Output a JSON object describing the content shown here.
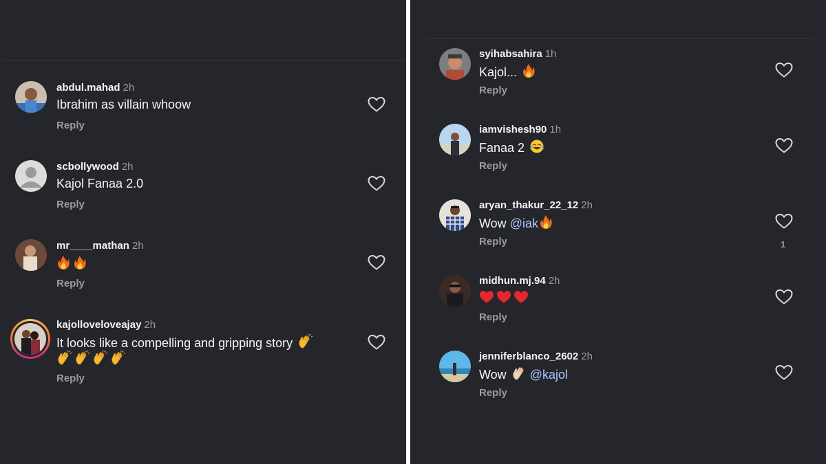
{
  "left": {
    "comments": [
      {
        "username": "abdul.mahad",
        "time": "2h",
        "text": "Ibrahim as villain whoow",
        "reply": "Reply"
      },
      {
        "username": "scbollywood",
        "time": "2h",
        "text": "Kajol Fanaa 2.0",
        "reply": "Reply"
      },
      {
        "username": "mr____mathan",
        "time": "2h",
        "text": "",
        "emoji": [
          "fire-emoji",
          "fire-emoji"
        ],
        "reply": "Reply"
      },
      {
        "username": "kajolloveloveajay",
        "time": "2h",
        "text": "It looks like a compelling and gripping story",
        "emoji": [
          "clapping-hands-emoji",
          "clapping-hands-emoji",
          "clapping-hands-emoji",
          "clapping-hands-emoji",
          "clapping-hands-emoji"
        ],
        "reply": "Reply"
      }
    ]
  },
  "right": {
    "comments": [
      {
        "username": "syihabsahira",
        "time": "1h",
        "text": "Kajol...",
        "emoji": [
          "fire-emoji"
        ],
        "reply": "Reply"
      },
      {
        "username": "iamvishesh90",
        "time": "1h",
        "text": "Fanaa 2",
        "emoji": [
          "tears-of-joy-emoji"
        ],
        "reply": "Reply"
      },
      {
        "username": "aryan_thakur_22_12",
        "time": "2h",
        "text": "Wow",
        "mention": "@iak",
        "emoji": [
          "fire-emoji"
        ],
        "reply": "Reply",
        "likes": "1"
      },
      {
        "username": "midhun.mj.94",
        "time": "2h",
        "text": "",
        "emoji": [
          "red-heart-emoji",
          "red-heart-emoji",
          "red-heart-emoji"
        ],
        "reply": "Reply"
      },
      {
        "username": "jenniferblanco_2602",
        "time": "2h",
        "text": "Wow",
        "emoji_before_mention": [
          "clapping-hands-emoji"
        ],
        "mention": "@kajol",
        "reply": "Reply"
      }
    ]
  },
  "colors": {
    "background": "#25262b",
    "text": "#f5f5f5",
    "muted": "#9a9ba0",
    "mention": "#a8c8ff",
    "divider": "#3a3b41"
  },
  "icons": {
    "like": "heart-outline-icon",
    "default_avatar": "default-avatar-icon"
  }
}
